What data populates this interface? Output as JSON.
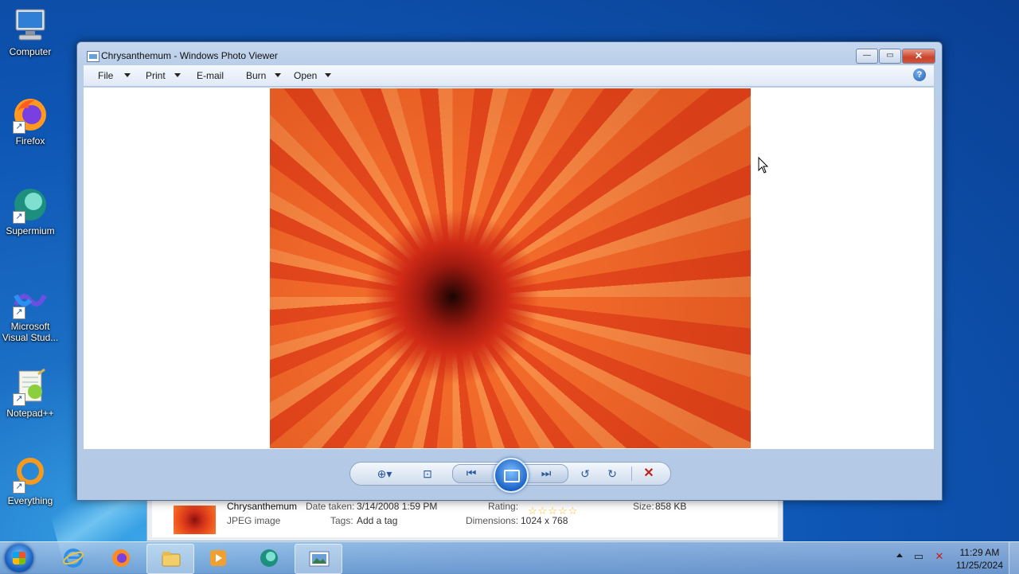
{
  "desktop": {
    "icons": [
      {
        "label": "Computer",
        "icon": "computer-icon"
      },
      {
        "label": "Firefox",
        "icon": "firefox-icon"
      },
      {
        "label": "Supermium",
        "icon": "supermium-icon"
      },
      {
        "label": "Microsoft Visual Stud...",
        "icon": "visual-studio-icon"
      },
      {
        "label": "Notepad++",
        "icon": "notepadpp-icon"
      },
      {
        "label": "Everything",
        "icon": "everything-icon"
      }
    ]
  },
  "window": {
    "title": "Chrysanthemum - Windows Photo Viewer",
    "menu": {
      "file": "File",
      "print": "Print",
      "email": "E-mail",
      "burn": "Burn",
      "open": "Open"
    },
    "help_glyph": "?",
    "caption": {
      "minimize": "—",
      "maximize": "▭",
      "close": "✕"
    }
  },
  "info": {
    "filename": "Chrysanthemum",
    "filetype": "JPEG image",
    "date_taken_label": "Date taken:",
    "date_taken": "3/14/2008 1:59 PM",
    "tags_label": "Tags:",
    "tags_value": "Add a tag",
    "rating_label": "Rating:",
    "rating_stars": "☆☆☆☆☆",
    "dimensions_label": "Dimensions:",
    "dimensions": "1024 x 768",
    "size_label": "Size:",
    "size": "858 KB"
  },
  "controls": {
    "zoom": "⊕▾",
    "actual_size": "⊡",
    "previous": "⏮",
    "next": "⏭",
    "rotate_ccw": "↺",
    "rotate_cw": "↻",
    "delete": "✕"
  },
  "taskbar": {
    "clock_time": "11:29 AM",
    "clock_date": "11/25/2024",
    "apps": [
      "ie-icon",
      "firefox-icon",
      "explorer-icon",
      "media-player-icon",
      "supermium-icon",
      "photo-viewer-icon"
    ],
    "tray": [
      "show-hidden-icons-arrow",
      "network-icon",
      "volume-muted-icon"
    ]
  },
  "colors": {
    "desktop_blue": "#0e56b4",
    "window_frame": "#b8cde8",
    "close_red": "#c8432a"
  }
}
